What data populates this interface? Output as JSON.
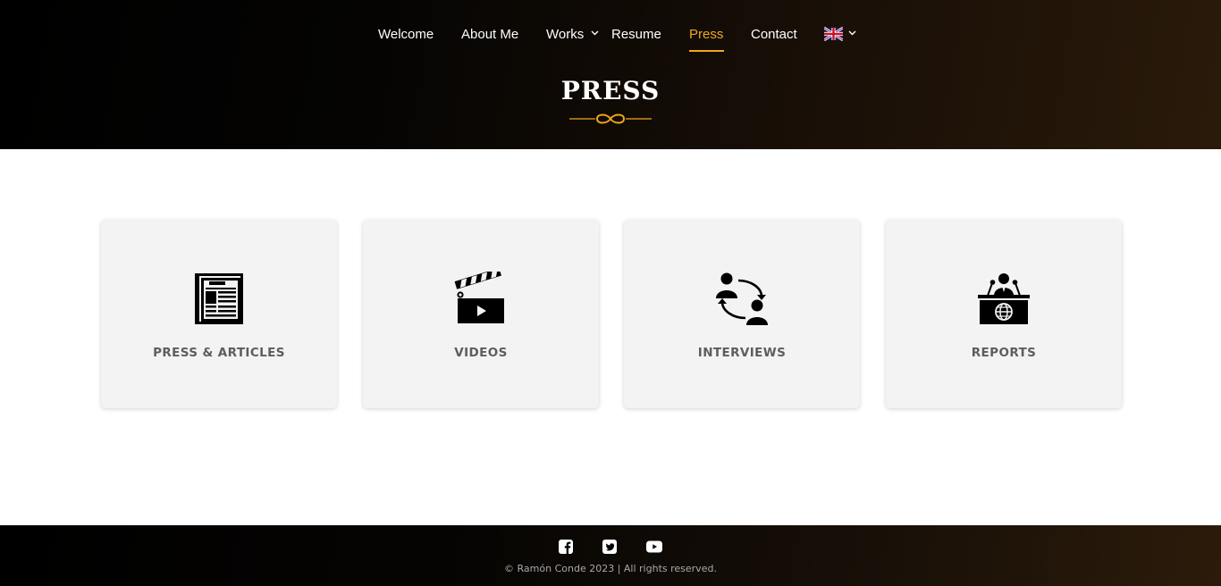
{
  "nav": {
    "items": [
      "Welcome",
      "About Me",
      "Works",
      "Resume",
      "Press",
      "Contact"
    ],
    "active": "Press",
    "accent_color": "#f0a81c",
    "language_icon": "uk-flag-icon"
  },
  "header": {
    "title": "PRESS",
    "divider_icon": "infinity-icon"
  },
  "cards": [
    {
      "label": "PRESS & ARTICLES",
      "icon": "newspaper-icon"
    },
    {
      "label": "VIDEOS",
      "icon": "clapperboard-icon"
    },
    {
      "label": "INTERVIEWS",
      "icon": "interview-icon"
    },
    {
      "label": "REPORTS",
      "icon": "press-conference-icon"
    }
  ],
  "footer": {
    "social": [
      "facebook-icon",
      "twitter-icon",
      "youtube-icon"
    ],
    "copyright": "© Ramón Conde 2023 | All rights reserved."
  }
}
